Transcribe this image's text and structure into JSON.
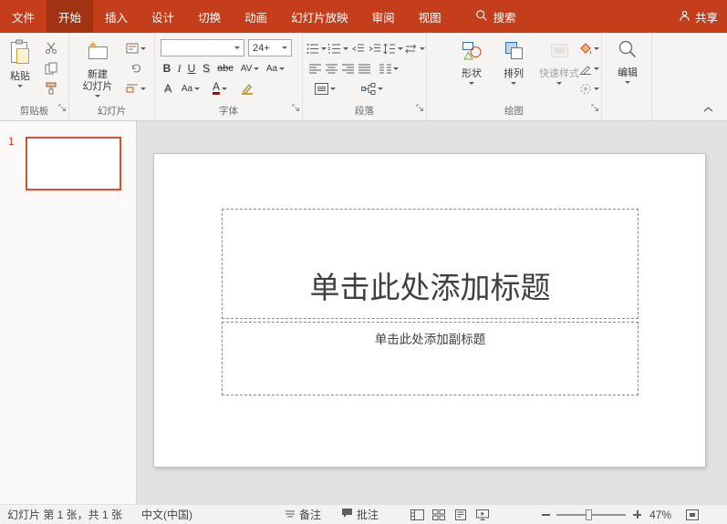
{
  "colors": {
    "accent": "#C43E1C",
    "accent_dark": "#A03312"
  },
  "tabbar": {
    "tabs": [
      {
        "label": "文件"
      },
      {
        "label": "开始"
      },
      {
        "label": "插入"
      },
      {
        "label": "设计"
      },
      {
        "label": "切换"
      },
      {
        "label": "动画"
      },
      {
        "label": "幻灯片放映"
      },
      {
        "label": "审阅"
      },
      {
        "label": "视图"
      }
    ],
    "search_label": "搜索",
    "share_label": "共享"
  },
  "ribbon": {
    "clipboard": {
      "paste_label": "粘贴",
      "group_label": "剪贴板"
    },
    "slides": {
      "new_slide_line1": "新建",
      "new_slide_line2": "幻灯片",
      "group_label": "幻灯片"
    },
    "font": {
      "font_name_value": "",
      "font_size_value": "24+",
      "bold": "B",
      "italic": "I",
      "underline": "U",
      "shadow": "S",
      "strike": "abc",
      "spacing": "AV",
      "case": "Aa",
      "color": "A",
      "clear": "A",
      "group_label": "字体"
    },
    "paragraph": {
      "group_label": "段落"
    },
    "drawing": {
      "shapes_label": "形状",
      "arrange_label": "排列",
      "quick_styles_label": "快速样式",
      "group_label": "绘图"
    },
    "editing": {
      "label": "编辑"
    }
  },
  "thumbnails": {
    "slide_number": "1"
  },
  "slide": {
    "title_placeholder": "单击此处添加标题",
    "subtitle_placeholder": "单击此处添加副标题"
  },
  "statusbar": {
    "slide_info": "幻灯片 第 1 张，共 1 张",
    "language": "中文(中国)",
    "notes_label": "备注",
    "comments_label": "批注",
    "zoom_value": "47%"
  }
}
